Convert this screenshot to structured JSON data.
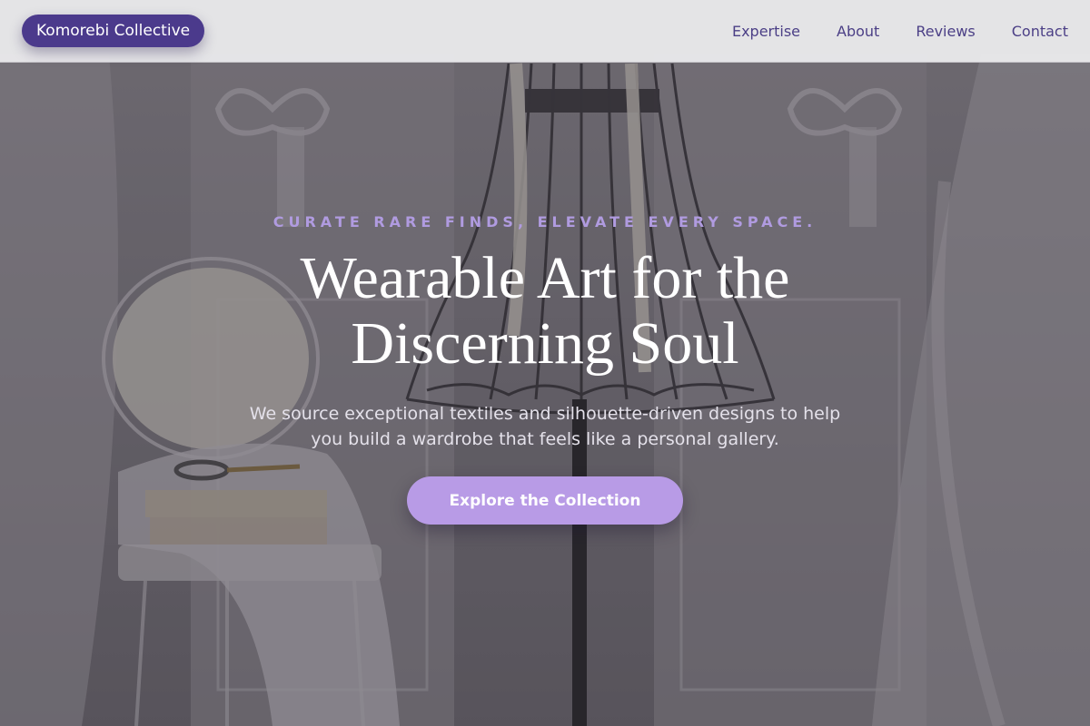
{
  "brand": {
    "name": "Komorebi Collective"
  },
  "nav": {
    "links": [
      {
        "label": "Expertise"
      },
      {
        "label": "About"
      },
      {
        "label": "Reviews"
      },
      {
        "label": "Contact"
      }
    ]
  },
  "hero": {
    "eyebrow": "CURATE RARE FINDS, ELEVATE EVERY SPACE.",
    "headline_line1": "Wearable Art for the",
    "headline_line2": "Discerning Soul",
    "subtext": "We source exceptional textiles and silhouette-driven designs to help you build a wardrobe that feels like a personal gallery.",
    "cta_label": "Explore the Collection"
  },
  "colors": {
    "brand_pill": "#4b3a8c",
    "nav_text": "#4b3f86",
    "eyebrow": "#b09be0",
    "cta": "#b89be6"
  },
  "background": {
    "subject": "wire dress form with measuring tape, vintage chair with fabric and scissors, ornate white panels and sheer curtains"
  }
}
